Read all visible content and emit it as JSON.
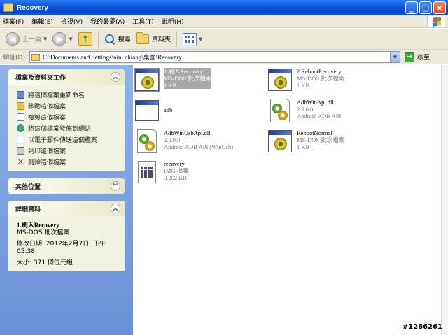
{
  "window": {
    "title": "Recovery",
    "buttons": {
      "minimize": "_",
      "maximize": "□",
      "close": "×"
    }
  },
  "menu": [
    "檔案(F)",
    "編輯(E)",
    "檢視(V)",
    "我的最愛(A)",
    "工具(T)",
    "說明(H)"
  ],
  "toolbar": {
    "back_label": "上一頁",
    "search_label": "搜尋",
    "folders_label": "資料夾"
  },
  "address": {
    "label": "網址(D)",
    "path": "C:\\Documents and Settings\\nini.chiang\\桌面\\Recovery",
    "go_label": "移至"
  },
  "taskpane": {
    "file_tasks": {
      "title": "檔案及資料夾工作",
      "items": [
        {
          "label": "將這個檔案重新命名",
          "icon": "rename-icon"
        },
        {
          "label": "移動這個檔案",
          "icon": "move-icon"
        },
        {
          "label": "複製這個檔案",
          "icon": "copy-icon"
        },
        {
          "label": "將這個檔案發佈到網站",
          "icon": "web-publish-icon"
        },
        {
          "label": "以電子郵件傳送這個檔案",
          "icon": "email-icon"
        },
        {
          "label": "列印這個檔案",
          "icon": "print-icon"
        },
        {
          "label": "刪除這個檔案",
          "icon": "delete-icon"
        }
      ]
    },
    "other_places": {
      "title": "其他位置"
    },
    "details": {
      "title": "詳細資料",
      "name": "1.刷入Recovery",
      "type": "MS-DOS 批次檔案",
      "modified": "修改日期: 2012年2月7日, 下午 05:38",
      "size": "大小: 371 個位元組"
    }
  },
  "files": [
    {
      "name": "1.刷入Recovery",
      "type": "MS-DOS 批次檔案",
      "size": "1 KB",
      "icon": "batch-file-icon",
      "selected": true
    },
    {
      "name": "2.RebootRecovery",
      "type": "MS-DOS 批次檔案",
      "size": "1 KB",
      "icon": "batch-file-icon",
      "selected": false
    },
    {
      "name": "adb",
      "type": "",
      "size": "",
      "icon": "exe-file-icon",
      "selected": false
    },
    {
      "name": "AdbWinApi.dll",
      "type": "2.0.0.0",
      "size": "Android ADB API",
      "icon": "dll-file-icon",
      "selected": false
    },
    {
      "name": "AdbWinUsbApi.dll",
      "type": "2.0.0.0",
      "size": "Android ADB API (WinUsb)",
      "icon": "dll-file-icon",
      "selected": false
    },
    {
      "name": "RebootNormal",
      "type": "MS-DOS 批次檔案",
      "size": "1 KB",
      "icon": "batch-file-icon",
      "selected": false
    },
    {
      "name": "recovery",
      "type": "IMG 檔案",
      "size": "9,202 KB",
      "icon": "img-file-icon",
      "selected": false
    }
  ],
  "watermark": "#1286261"
}
